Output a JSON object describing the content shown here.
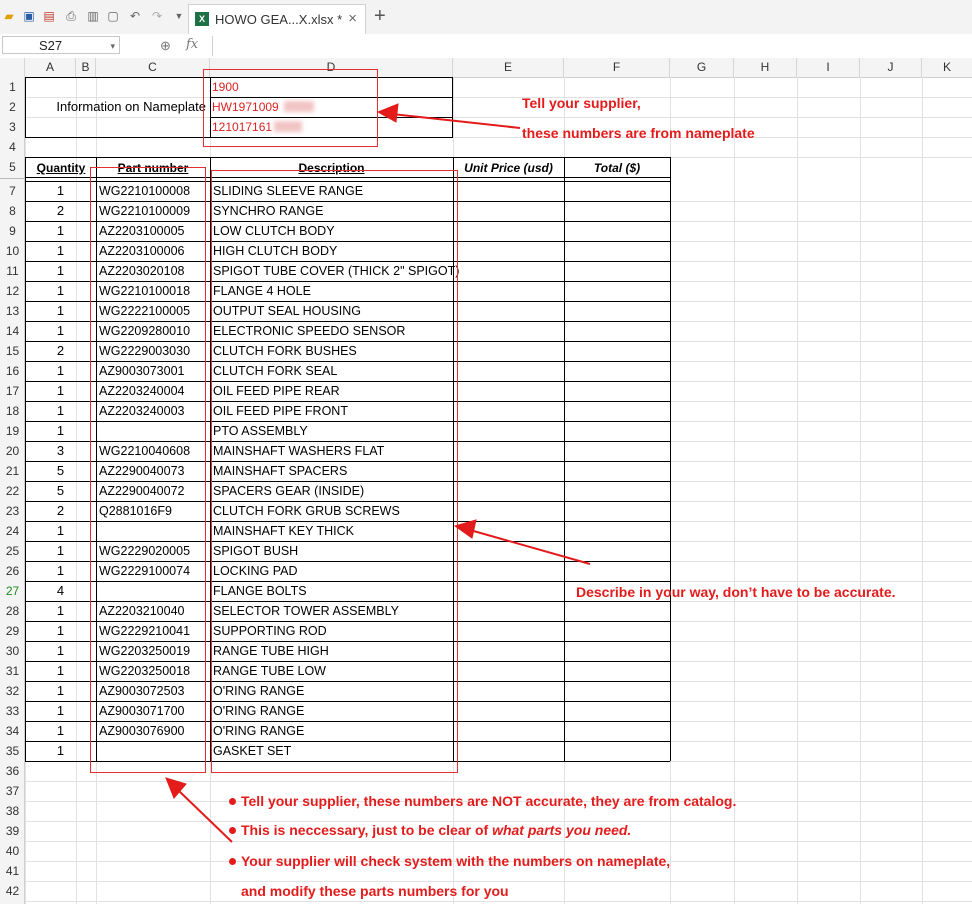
{
  "toolbar": {
    "icons": [
      "open-icon",
      "save-icon",
      "export-pdf-icon",
      "print-icon",
      "print-preview-icon",
      "page-icon",
      "undo-icon",
      "redo-icon",
      "more-icon"
    ],
    "tab_title": "HOWO GEA...X.xlsx *",
    "tab_close": "×",
    "new_tab": "+"
  },
  "formula_bar": {
    "name_box": "S27",
    "fx_label": "fx",
    "formula": ""
  },
  "columns": [
    "A",
    "B",
    "C",
    "D",
    "E",
    "F",
    "G",
    "H",
    "I",
    "J",
    "K"
  ],
  "rows": [
    "1",
    "2",
    "3",
    "4",
    "5",
    "7",
    "8",
    "9",
    "10",
    "11",
    "12",
    "13",
    "14",
    "15",
    "16",
    "17",
    "18",
    "19",
    "20",
    "21",
    "22",
    "23",
    "24",
    "25",
    "26",
    "27",
    "28",
    "29",
    "30",
    "31",
    "32",
    "33",
    "34",
    "35",
    "36",
    "37",
    "38",
    "39",
    "40",
    "41",
    "42"
  ],
  "selected_row": "27",
  "nameplate": {
    "label": "Information on Nameplate",
    "values": [
      "1900",
      "HW1971009",
      "121017161"
    ]
  },
  "table": {
    "headers": {
      "quantity": "Quantity",
      "part_number": "Part number",
      "description": "Description",
      "unit_price": "Unit Price (usd)",
      "total": "Total ($)"
    },
    "rows": [
      {
        "qty": "1",
        "part": "WG2210100008",
        "desc": "SLIDING SLEEVE RANGE"
      },
      {
        "qty": "2",
        "part": "WG2210100009",
        "desc": "SYNCHRO RANGE"
      },
      {
        "qty": "1",
        "part": "AZ2203100005",
        "desc": "LOW CLUTCH BODY"
      },
      {
        "qty": "1",
        "part": "AZ2203100006",
        "desc": "HIGH CLUTCH BODY"
      },
      {
        "qty": "1",
        "part": "AZ2203020108",
        "desc": "SPIGOT TUBE COVER (THICK 2\" SPIGOT)"
      },
      {
        "qty": "1",
        "part": "WG2210100018",
        "desc": "FLANGE 4 HOLE"
      },
      {
        "qty": "1",
        "part": "WG2222100005",
        "desc": "OUTPUT SEAL HOUSING"
      },
      {
        "qty": "1",
        "part": "WG2209280010",
        "desc": "ELECTRONIC SPEEDO SENSOR"
      },
      {
        "qty": "2",
        "part": "WG2229003030",
        "desc": "CLUTCH FORK BUSHES"
      },
      {
        "qty": "1",
        "part": "AZ9003073001",
        "desc": "CLUTCH FORK SEAL"
      },
      {
        "qty": "1",
        "part": "AZ2203240004",
        "desc": "OIL FEED PIPE REAR"
      },
      {
        "qty": "1",
        "part": "AZ2203240003",
        "desc": "OIL FEED PIPE FRONT"
      },
      {
        "qty": "1",
        "part": "",
        "desc": "PTO ASSEMBLY"
      },
      {
        "qty": "3",
        "part": "WG2210040608",
        "desc": "MAINSHAFT WASHERS FLAT"
      },
      {
        "qty": "5",
        "part": "AZ2290040073",
        "desc": "MAINSHAFT SPACERS"
      },
      {
        "qty": "5",
        "part": "AZ2290040072",
        "desc": "SPACERS GEAR (INSIDE)"
      },
      {
        "qty": "2",
        "part": "Q2881016F9",
        "desc": "CLUTCH FORK GRUB SCREWS"
      },
      {
        "qty": "1",
        "part": "",
        "desc": "MAINSHAFT KEY THICK"
      },
      {
        "qty": "1",
        "part": "WG2229020005",
        "desc": "SPIGOT BUSH"
      },
      {
        "qty": "1",
        "part": "WG2229100074",
        "desc": "LOCKING PAD"
      },
      {
        "qty": "4",
        "part": "",
        "desc": "FLANGE BOLTS"
      },
      {
        "qty": "1",
        "part": "AZ2203210040",
        "desc": "SELECTOR TOWER ASSEMBLY"
      },
      {
        "qty": "1",
        "part": "WG2229210041",
        "desc": "SUPPORTING ROD"
      },
      {
        "qty": "1",
        "part": "WG2203250019",
        "desc": "RANGE TUBE HIGH"
      },
      {
        "qty": "1",
        "part": "WG2203250018",
        "desc": "RANGE TUBE LOW"
      },
      {
        "qty": "1",
        "part": "AZ9003072503",
        "desc": "O'RING RANGE"
      },
      {
        "qty": "1",
        "part": "AZ9003071700",
        "desc": "O'RING RANGE"
      },
      {
        "qty": "1",
        "part": "AZ9003076900",
        "desc": "O'RING RANGE"
      },
      {
        "qty": "1",
        "part": "",
        "desc": "GASKET SET"
      }
    ]
  },
  "annotations": {
    "nameplate_line1": "Tell your supplier,",
    "nameplate_line2": "these numbers are from nameplate",
    "describe": "Describe in your way, don’t have to be accurate.",
    "notes": [
      "Tell your supplier, these numbers are NOT accurate, they are from catalog.",
      "This is neccessary, just to be clear of ",
      "Your supplier will check system with the numbers on nameplate,",
      "and modify these parts numbers for you"
    ],
    "notes_emphasis": "what parts you need."
  },
  "colors": {
    "annotation_red": "#e31b1b",
    "selected_row_green": "#1c8a1c",
    "excel_green": "#1e7145"
  }
}
